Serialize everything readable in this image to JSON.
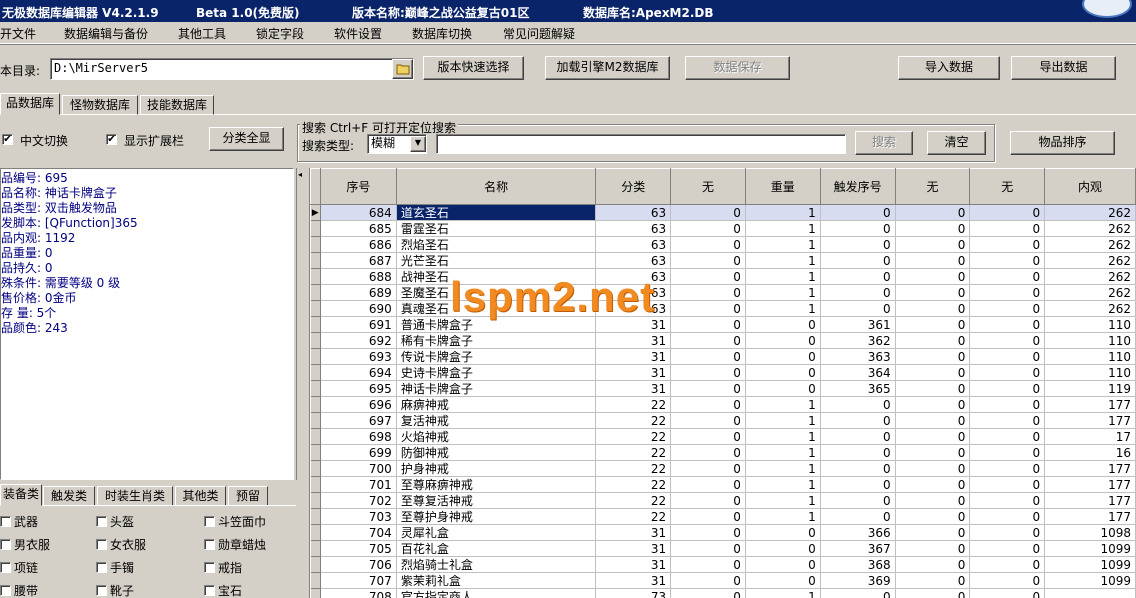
{
  "window": {
    "app_title": "无极数据库编辑器 V4.2.1.9",
    "edition": "Beta 1.0(免费版)",
    "version_name": "版本名称:巅峰之战公益复古01区",
    "db_name": "数据库名:ApexM2.DB"
  },
  "menu": [
    "开文件",
    "数据编辑与备份",
    "其他工具",
    "锁定字段",
    "软件设置",
    "数据库切换",
    "常见问题解疑"
  ],
  "toolbar": {
    "dir_label": "本目录:",
    "dir_value": "D:\\MirServer5",
    "quick_select": "版本快速选择",
    "load_engine": "加载引擎M2数据库",
    "save_data": "数据保存",
    "import_data": "导入数据",
    "export_data": "导出数据"
  },
  "tabs": [
    "品数据库",
    "怪物数据库",
    "技能数据库"
  ],
  "options": {
    "chinese_switch": "中文切换",
    "show_ext": "显示扩展栏",
    "expand_all": "分类全显"
  },
  "search": {
    "group_title": "搜索  Ctrl+F 可打开定位搜索",
    "type_label": "搜索类型:",
    "type_value": "模糊",
    "search_button": "搜索",
    "clear_button": "清空",
    "sort_button": "物品排序"
  },
  "info": [
    "品编号: 695",
    "品名称: 神话卡牌盒子",
    "品类型: 双击触发物品",
    "发脚本: [QFunction]365",
    "品内观: 1192",
    "品重量: 0",
    "品持久: 0",
    "殊条件: 需要等级 0 级",
    "售价格: 0金币",
    " 存 量: 5个",
    "品颜色: 243"
  ],
  "bottom_tabs": [
    "装备类",
    "触发类",
    "时装生肖类",
    "其他类",
    "预留"
  ],
  "bottom_checks": [
    [
      "武器",
      "头盔",
      "斗笠面巾"
    ],
    [
      "男衣服",
      "女衣服",
      "勋章蜡烛"
    ],
    [
      "项链",
      "手镯",
      "戒指"
    ],
    [
      "腰带",
      "靴子",
      "宝石"
    ]
  ],
  "grid": {
    "headers": [
      "序号",
      "名称",
      "分类",
      "无",
      "重量",
      "触发序号",
      "无",
      "无",
      "内观"
    ],
    "rows": [
      [
        "684",
        "道玄圣石",
        "63",
        "0",
        "1",
        "0",
        "0",
        "0",
        "262"
      ],
      [
        "685",
        "雷霆圣石",
        "63",
        "0",
        "1",
        "0",
        "0",
        "0",
        "262"
      ],
      [
        "686",
        "烈焰圣石",
        "63",
        "0",
        "1",
        "0",
        "0",
        "0",
        "262"
      ],
      [
        "687",
        "光芒圣石",
        "63",
        "0",
        "1",
        "0",
        "0",
        "0",
        "262"
      ],
      [
        "688",
        "战神圣石",
        "63",
        "0",
        "1",
        "0",
        "0",
        "0",
        "262"
      ],
      [
        "689",
        "圣魔圣石",
        "63",
        "0",
        "1",
        "0",
        "0",
        "0",
        "262"
      ],
      [
        "690",
        "真魂圣石",
        "63",
        "0",
        "1",
        "0",
        "0",
        "0",
        "262"
      ],
      [
        "691",
        "普通卡牌盒子",
        "31",
        "0",
        "0",
        "361",
        "0",
        "0",
        "110"
      ],
      [
        "692",
        "稀有卡牌盒子",
        "31",
        "0",
        "0",
        "362",
        "0",
        "0",
        "110"
      ],
      [
        "693",
        "传说卡牌盒子",
        "31",
        "0",
        "0",
        "363",
        "0",
        "0",
        "110"
      ],
      [
        "694",
        "史诗卡牌盒子",
        "31",
        "0",
        "0",
        "364",
        "0",
        "0",
        "110"
      ],
      [
        "695",
        "神话卡牌盒子",
        "31",
        "0",
        "0",
        "365",
        "0",
        "0",
        "119"
      ],
      [
        "696",
        "麻痹神戒",
        "22",
        "0",
        "1",
        "0",
        "0",
        "0",
        "177"
      ],
      [
        "697",
        "复活神戒",
        "22",
        "0",
        "1",
        "0",
        "0",
        "0",
        "177"
      ],
      [
        "698",
        "火焰神戒",
        "22",
        "0",
        "1",
        "0",
        "0",
        "0",
        "17"
      ],
      [
        "699",
        "防御神戒",
        "22",
        "0",
        "1",
        "0",
        "0",
        "0",
        "16"
      ],
      [
        "700",
        "护身神戒",
        "22",
        "0",
        "1",
        "0",
        "0",
        "0",
        "177"
      ],
      [
        "701",
        "至尊麻痹神戒",
        "22",
        "0",
        "1",
        "0",
        "0",
        "0",
        "177"
      ],
      [
        "702",
        "至尊复活神戒",
        "22",
        "0",
        "1",
        "0",
        "0",
        "0",
        "177"
      ],
      [
        "703",
        "至尊护身神戒",
        "22",
        "0",
        "1",
        "0",
        "0",
        "0",
        "177"
      ],
      [
        "704",
        "灵犀礼盒",
        "31",
        "0",
        "0",
        "366",
        "0",
        "0",
        "1098"
      ],
      [
        "705",
        "百花礼盒",
        "31",
        "0",
        "0",
        "367",
        "0",
        "0",
        "1099"
      ],
      [
        "706",
        "烈焰骑士礼盒",
        "31",
        "0",
        "0",
        "368",
        "0",
        "0",
        "1099"
      ],
      [
        "707",
        "紫茉莉礼盒",
        "31",
        "0",
        "0",
        "369",
        "0",
        "0",
        "1099"
      ],
      [
        "708",
        "官方指定商人",
        "73",
        "0",
        "1",
        "0",
        "0",
        "0",
        ""
      ]
    ]
  },
  "watermark": "lspm2.net"
}
